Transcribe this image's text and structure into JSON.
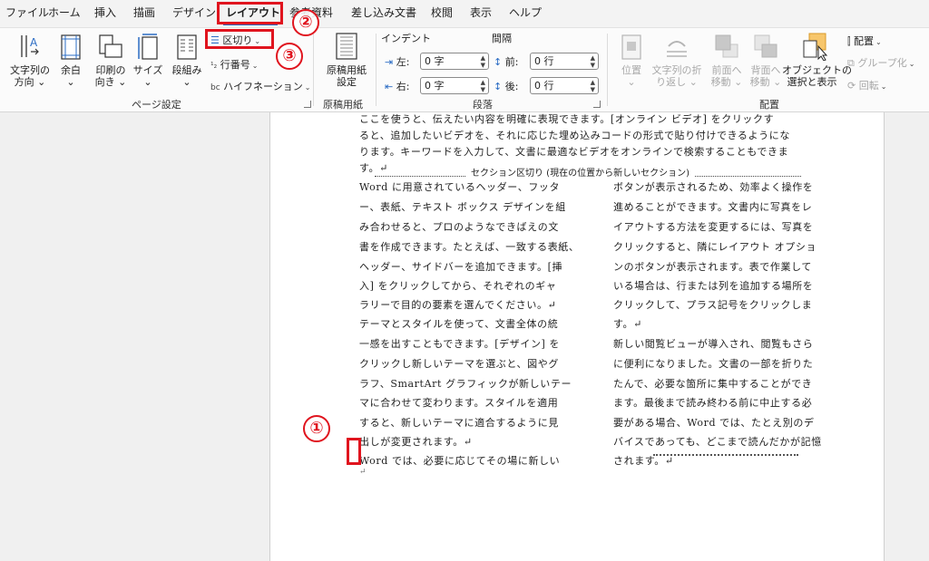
{
  "tabs": [
    "ファイル",
    "ホーム",
    "挿入",
    "描画",
    "デザイン",
    "レイアウト",
    "参考資料",
    "差し込み文書",
    "校閲",
    "表示",
    "ヘルプ"
  ],
  "ribbon": {
    "page_setup": {
      "text_direction": [
        "文字列の",
        "方向 ⌄"
      ],
      "margins": [
        "余白",
        "⌄"
      ],
      "orientation": [
        "印刷の",
        "向き ⌄"
      ],
      "size": [
        "サイズ",
        "⌄"
      ],
      "columns": [
        "段組み",
        "⌄"
      ],
      "breaks": "区切り",
      "line_numbers": "行番号",
      "hyphenation": "ハイフネーション",
      "group_label": "ページ設定"
    },
    "manuscript": {
      "button": [
        "原稿用紙",
        "設定"
      ],
      "group_label": "原稿用紙"
    },
    "paragraph": {
      "indent_header": "インデント",
      "spacing_header": "間隔",
      "left_label": "左:",
      "right_label": "右:",
      "before_label": "前:",
      "after_label": "後:",
      "left_value": "0 字",
      "right_value": "0 字",
      "before_value": "0 行",
      "after_value": "0 行",
      "group_label": "段落"
    },
    "arrange": {
      "position": [
        "位置",
        "⌄"
      ],
      "wrap_text": [
        "文字列の折",
        "り返し ⌄"
      ],
      "bring_forward": [
        "前面へ",
        "移動 ⌄"
      ],
      "send_backward": [
        "背面へ",
        "移動 ⌄"
      ],
      "selection_pane": [
        "オブジェクトの",
        "選択と表示"
      ],
      "align": "配置",
      "group": "グループ化",
      "rotate": "回転",
      "group_label": "配置"
    }
  },
  "document": {
    "intro_lines": [
      "ここを使うと、伝えたい内容を明確に表現できます。[オンライン ビデオ] をクリックす",
      "ると、追加したいビデオを、それに応じた埋め込みコードの形式で貼り付けできるようにな",
      "ります。キーワードを入力して、文書に最適なビデオをオンラインで検索することもできま",
      "す。↵"
    ],
    "section_break": "セクション区切り (現在の位置から新しいセクション)",
    "left_column": [
      "Word に用意されているヘッダー、フッタ",
      "ー、表紙、テキスト ボックス デザインを組",
      "み合わせると、プロのようなできばえの文",
      "書を作成できます。たとえば、一致する表紙、",
      "ヘッダー、サイドバーを追加できます。[挿",
      "入] をクリックしてから、それぞれのギャ",
      "ラリーで目的の要素を選んでください。↵",
      "テーマとスタイルを使って、文書全体の統",
      "一感を出すこともできます。[デザイン] を",
      "クリックし新しいテーマを選ぶと、図やグ",
      "ラフ、SmartArt グラフィックが新しいテー",
      "マに合わせて変わります。スタイルを適用",
      "すると、新しいテーマに適合するように見",
      "出しが変更されます。↵",
      "Word では、必要に応じてその場に新しい"
    ],
    "right_column": [
      "ボタンが表示されるため、効率よく操作を",
      "進めることができます。文書内に写真をレ",
      "イアウトする方法を変更するには、写真を",
      "クリックすると、隣にレイアウト オプショ",
      "ンのボタンが表示されます。表で作業して",
      "いる場合は、行または列を追加する場所を",
      "クリックして、プラス記号をクリックしま",
      "す。↵",
      "新しい閲覧ビューが導入され、閲覧もさら",
      "に便利になりました。文書の一部を折りた",
      "たんで、必要な箇所に集中することができ",
      "ます。最後まで読み終わる前に中止する必",
      "要がある場合、Word では、たとえ別のデ",
      "バイスであっても、どこまで読んだかが記憶",
      "されます。↵"
    ],
    "end_mark": "↵"
  },
  "annotations": {
    "step1": "①",
    "step2": "②",
    "step3": "③",
    "color": "#e0141e"
  }
}
